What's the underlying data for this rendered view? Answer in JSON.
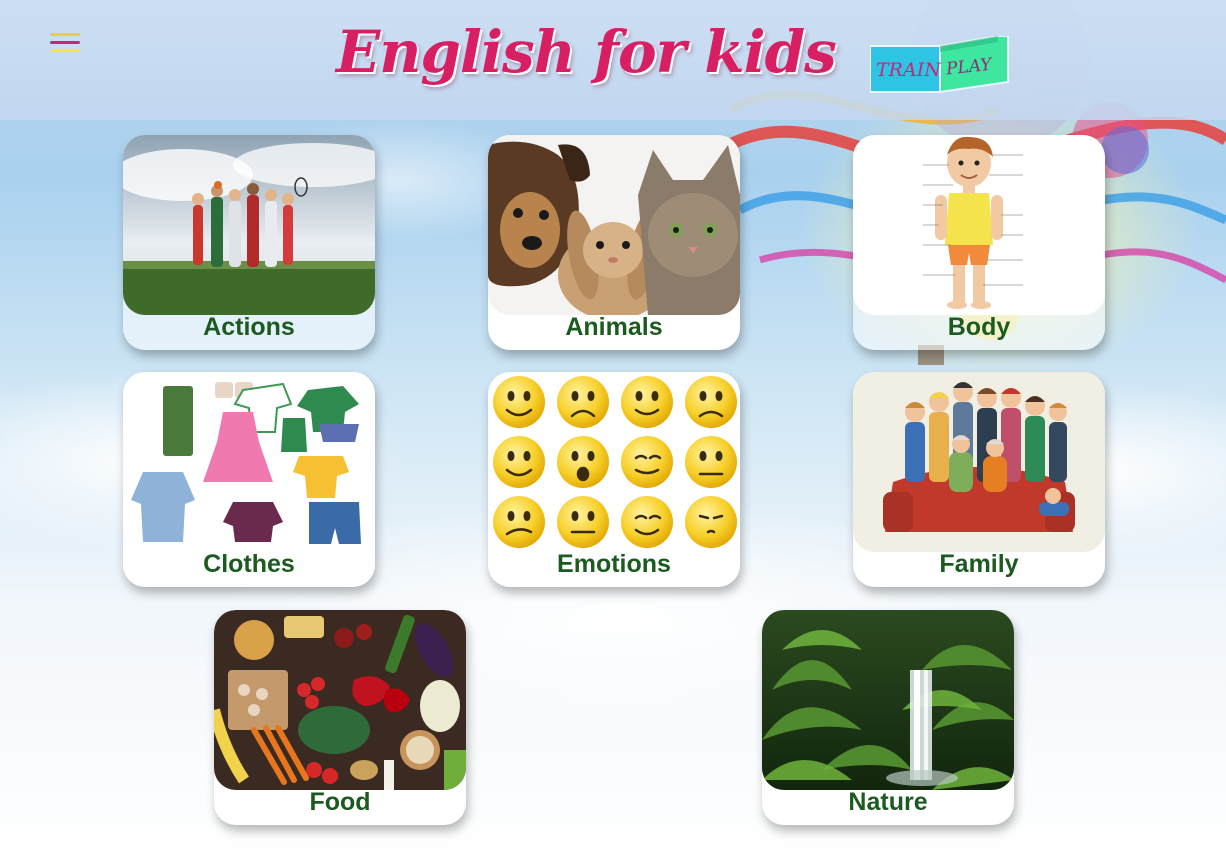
{
  "header": {
    "title": "English for kids",
    "menu_icon": "hamburger-menu-icon",
    "mode_switch": {
      "train_label": "TRAIN",
      "play_label": "PLAY"
    }
  },
  "categories": [
    {
      "label": "Actions",
      "icon": "actions-photo"
    },
    {
      "label": "Animals",
      "icon": "animals-photo"
    },
    {
      "label": "Body",
      "icon": "body-diagram"
    },
    {
      "label": "Clothes",
      "icon": "clothes-photo"
    },
    {
      "label": "Emotions",
      "icon": "emotions-photo"
    },
    {
      "label": "Family",
      "icon": "family-illustration"
    },
    {
      "label": "Food",
      "icon": "food-photo"
    },
    {
      "label": "Nature",
      "icon": "nature-photo"
    }
  ],
  "colors": {
    "title": "#d81f63",
    "label": "#1c5b1f",
    "train_bg": "#2fc4e3",
    "play_bg": "#3fe6a0"
  }
}
